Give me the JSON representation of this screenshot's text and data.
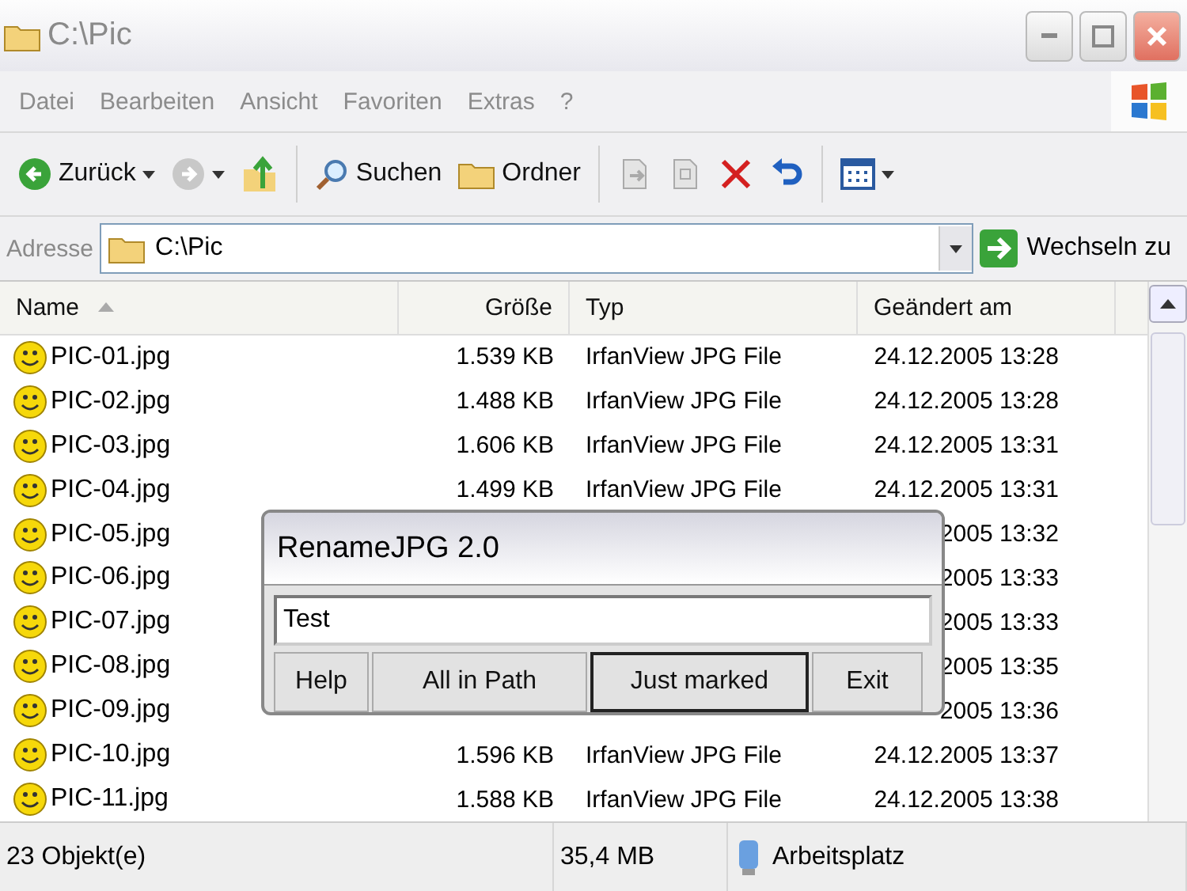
{
  "window": {
    "title": "C:\\Pic"
  },
  "menu": [
    "Datei",
    "Bearbeiten",
    "Ansicht",
    "Favoriten",
    "Extras",
    "?"
  ],
  "toolbar": [
    {
      "kind": "back",
      "label": "Zurück"
    },
    {
      "kind": "forward"
    },
    {
      "kind": "up"
    },
    {
      "kind": "search",
      "label": "Suchen"
    },
    {
      "kind": "folders",
      "label": "Ordner"
    },
    {
      "kind": "move"
    },
    {
      "kind": "copy"
    },
    {
      "kind": "delete"
    },
    {
      "kind": "undo"
    },
    {
      "kind": "views"
    }
  ],
  "address": {
    "label": "Adresse",
    "value": "C:\\Pic",
    "go": "Wechseln zu"
  },
  "table": {
    "columns": [
      {
        "label": "Name",
        "sorted": true
      },
      {
        "label": "Größe",
        "sorted": false
      },
      {
        "label": "Typ",
        "sorted": false
      },
      {
        "label": "Geändert am",
        "sorted": false
      }
    ],
    "rows": [
      {
        "name": "PIC-01.jpg",
        "size": "1.539 KB",
        "type": "IrfanView JPG File",
        "modified": "24.12.2005 13:28"
      },
      {
        "name": "PIC-02.jpg",
        "size": "1.488 KB",
        "type": "IrfanView JPG File",
        "modified": "24.12.2005 13:28"
      },
      {
        "name": "PIC-03.jpg",
        "size": "1.606 KB",
        "type": "IrfanView JPG File",
        "modified": "24.12.2005 13:31"
      },
      {
        "name": "PIC-04.jpg",
        "size": "1.499 KB",
        "type": "IrfanView JPG File",
        "modified": "24.12.2005 13:31"
      },
      {
        "name": "PIC-05.jpg",
        "modified": "2005 13:32"
      },
      {
        "name": "PIC-06.jpg",
        "modified": "2005 13:33"
      },
      {
        "name": "PIC-07.jpg",
        "modified": "2005 13:33"
      },
      {
        "name": "PIC-08.jpg",
        "modified": "2005 13:35"
      },
      {
        "name": "PIC-09.jpg",
        "modified": "2005 13:36"
      },
      {
        "name": "PIC-10.jpg",
        "size": "1.596 KB",
        "type": "IrfanView JPG File",
        "modified": "24.12.2005 13:37"
      },
      {
        "name": "PIC-11.jpg",
        "size": "1.588 KB",
        "type": "IrfanView JPG File",
        "modified": "24.12.2005 13:38"
      }
    ]
  },
  "dialog": {
    "title": "RenameJPG 2.0",
    "value": "Test",
    "buttons": [
      {
        "label": "Help",
        "focused": false
      },
      {
        "label": "All in Path",
        "focused": false
      },
      {
        "label": "Just marked",
        "focused": true
      },
      {
        "label": "Exit",
        "focused": false
      }
    ]
  },
  "status_bar": {
    "objects": "23 Objekt(e)",
    "size": "35,4 MB",
    "location": "Arbeitsplatz"
  }
}
